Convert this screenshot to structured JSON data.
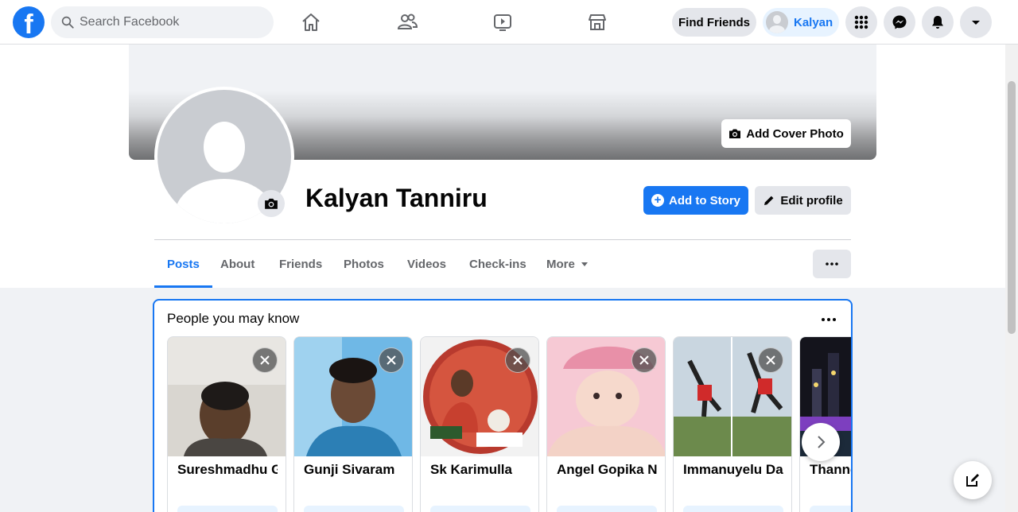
{
  "topbar": {
    "logo_letter": "f",
    "search_placeholder": "Search Facebook",
    "nav_icons": [
      "home-icon",
      "friends-icon",
      "watch-icon",
      "marketplace-icon"
    ],
    "find_friends_label": "Find Friends",
    "user_name": "Kalyan",
    "right_icons": [
      "menu-grid-icon",
      "messenger-icon",
      "notifications-bell-icon",
      "account-caret-icon"
    ]
  },
  "profile": {
    "name": "Kalyan Tanniru",
    "add_cover_label": "Add Cover Photo",
    "add_story_label": "Add to Story",
    "edit_profile_label": "Edit profile",
    "tabs": [
      {
        "label": "Posts",
        "active": true
      },
      {
        "label": "About"
      },
      {
        "label": "Friends"
      },
      {
        "label": "Photos"
      },
      {
        "label": "Videos"
      },
      {
        "label": "Check-ins"
      },
      {
        "label": "More"
      }
    ]
  },
  "pymk": {
    "title": "People you may know",
    "people": [
      {
        "name": "Sureshmadhu Gu"
      },
      {
        "name": "Gunji Sivaram"
      },
      {
        "name": "Sk Karimulla"
      },
      {
        "name": "Angel Gopika Na"
      },
      {
        "name": "Immanuyelu Dar"
      },
      {
        "name": "Thanne"
      }
    ]
  },
  "colors": {
    "brand": "#1877f2",
    "secondary_button": "#e4e6eb",
    "page_bg": "#f0f2f5"
  }
}
